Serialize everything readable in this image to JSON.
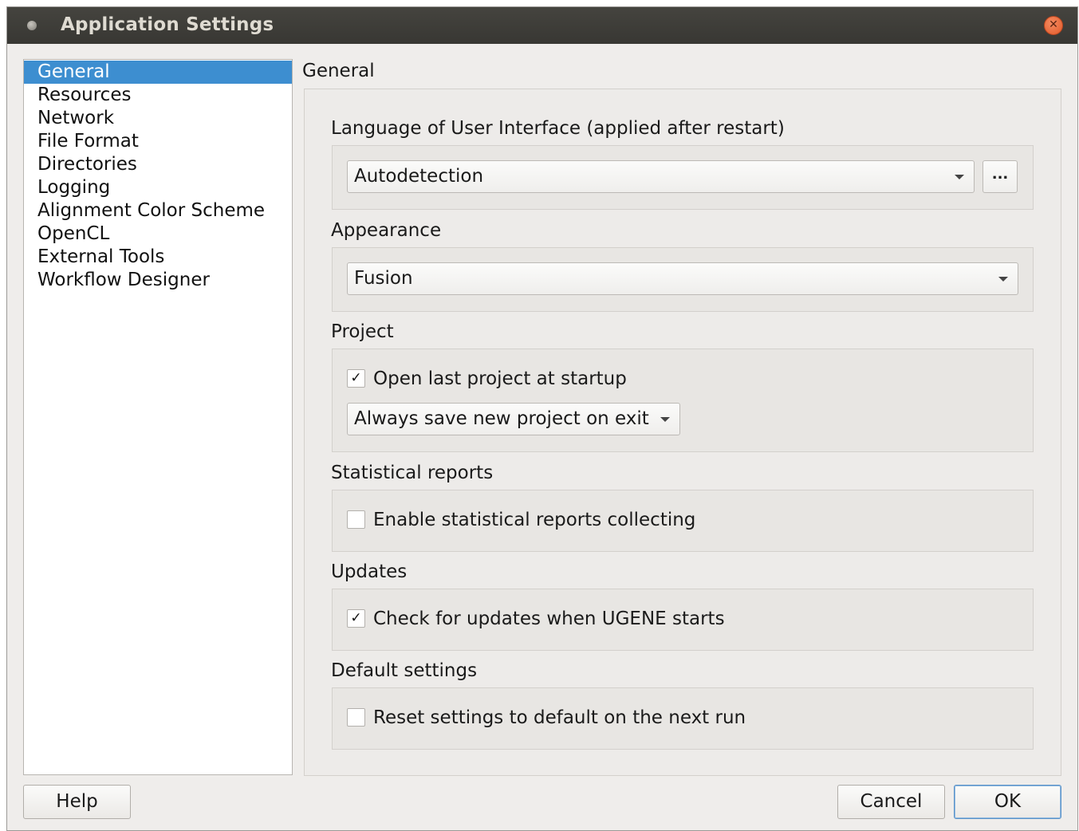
{
  "window": {
    "title": "Application Settings"
  },
  "categories": [
    {
      "label": "General",
      "selected": true
    },
    {
      "label": "Resources"
    },
    {
      "label": "Network"
    },
    {
      "label": "File Format"
    },
    {
      "label": "Directories"
    },
    {
      "label": "Logging"
    },
    {
      "label": "Alignment Color Scheme"
    },
    {
      "label": "OpenCL"
    },
    {
      "label": "External Tools"
    },
    {
      "label": "Workflow Designer"
    }
  ],
  "page": {
    "title": "General",
    "language": {
      "label": "Language of User Interface (applied after restart)",
      "value": "Autodetection",
      "browse_label": "..."
    },
    "appearance": {
      "label": "Appearance",
      "value": "Fusion"
    },
    "project": {
      "label": "Project",
      "open_last_label": "Open last project at startup",
      "open_last_checked": true,
      "save_mode_value": "Always save new project on exit"
    },
    "statistical": {
      "label": "Statistical reports",
      "enable_label": "Enable statistical reports collecting",
      "enable_checked": false
    },
    "updates": {
      "label": "Updates",
      "check_label": "Check for updates when UGENE starts",
      "check_checked": true
    },
    "defaults": {
      "label": "Default settings",
      "reset_label": "Reset settings to default on the next run",
      "reset_checked": false
    }
  },
  "buttons": {
    "help": "Help",
    "cancel": "Cancel",
    "ok": "OK"
  },
  "icons": {
    "checkmark": "✓",
    "close": "✕"
  },
  "colors": {
    "selection": "#3d8ed0",
    "titlebar": "#3c3b37",
    "close_button": "#e9643a"
  }
}
